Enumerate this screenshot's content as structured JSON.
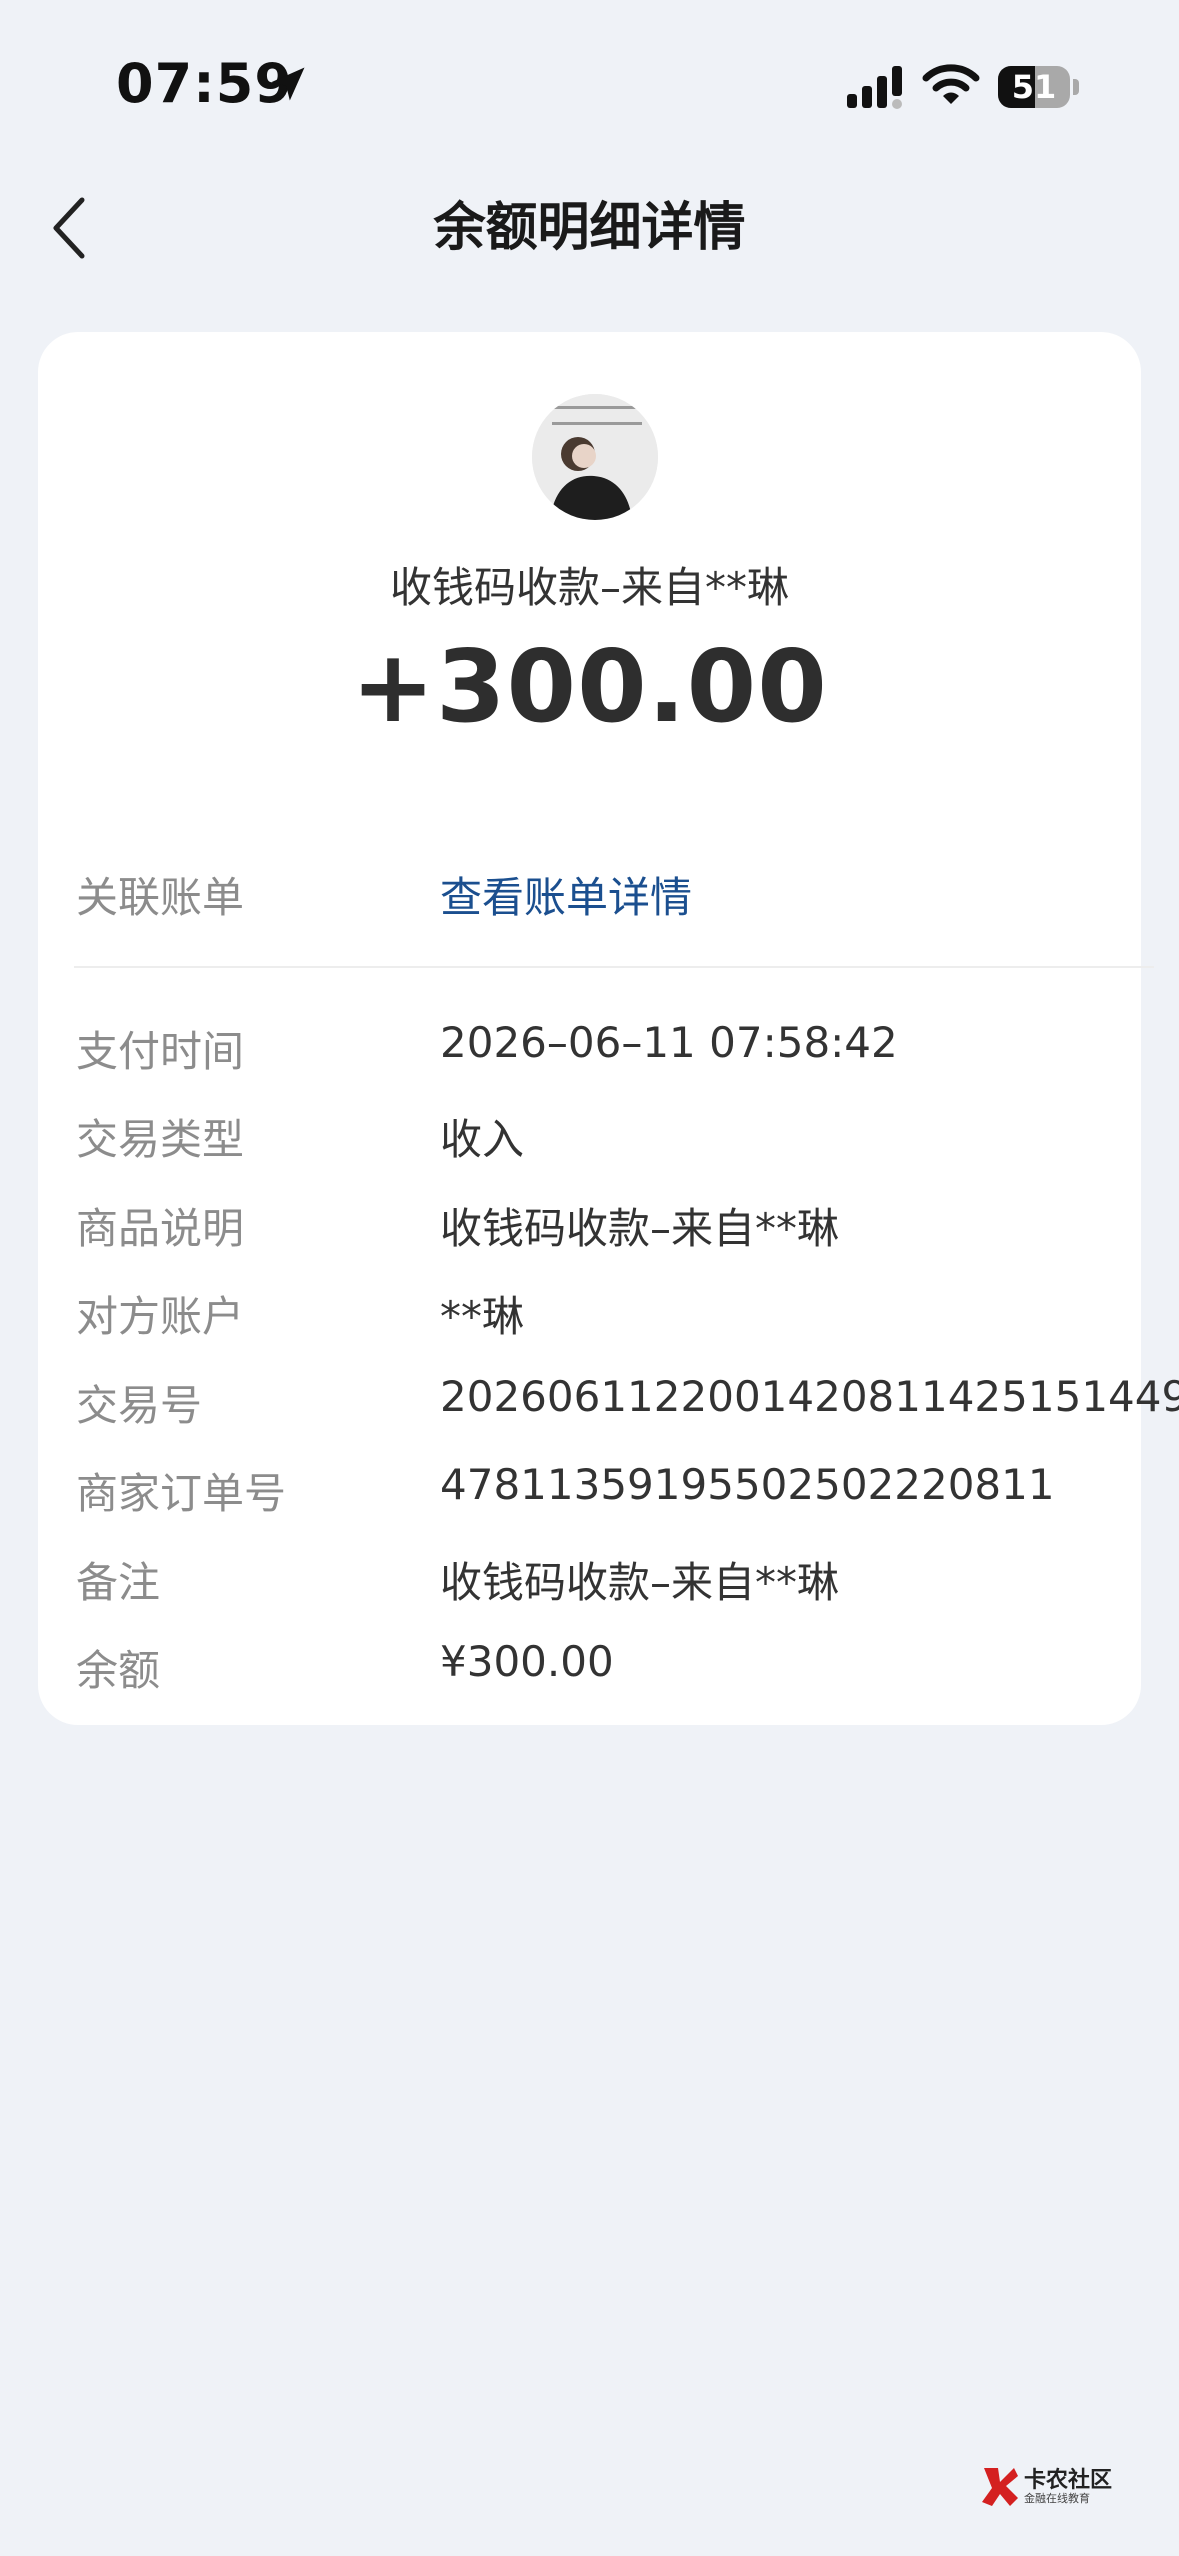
{
  "status": {
    "time": "07:59",
    "battery": "51",
    "battery_level": 0.51
  },
  "header": {
    "title": "余额明细详情"
  },
  "summary": {
    "payer": "收钱码收款–来自**琳",
    "amount": "+300.00"
  },
  "related": {
    "label": "关联账单",
    "link": "查看账单详情"
  },
  "details": [
    {
      "label": "支付时间",
      "value": "2026–06–11 07:58:42"
    },
    {
      "label": "交易类型",
      "value": "收入"
    },
    {
      "label": "商品说明",
      "value": "收钱码收款–来自**琳"
    },
    {
      "label": "对方账户",
      "value": "**琳"
    },
    {
      "label": "交易号",
      "value": "2026061122001420811425151449"
    },
    {
      "label": "商家订单号",
      "value": "4781135919550250222081​1"
    },
    {
      "label": "备注",
      "value": "收钱码收款–来自**琳"
    },
    {
      "label": "余额",
      "value": "¥300.00"
    }
  ],
  "watermark": {
    "title": "卡农社区",
    "subtitle": "金融在线教育"
  }
}
